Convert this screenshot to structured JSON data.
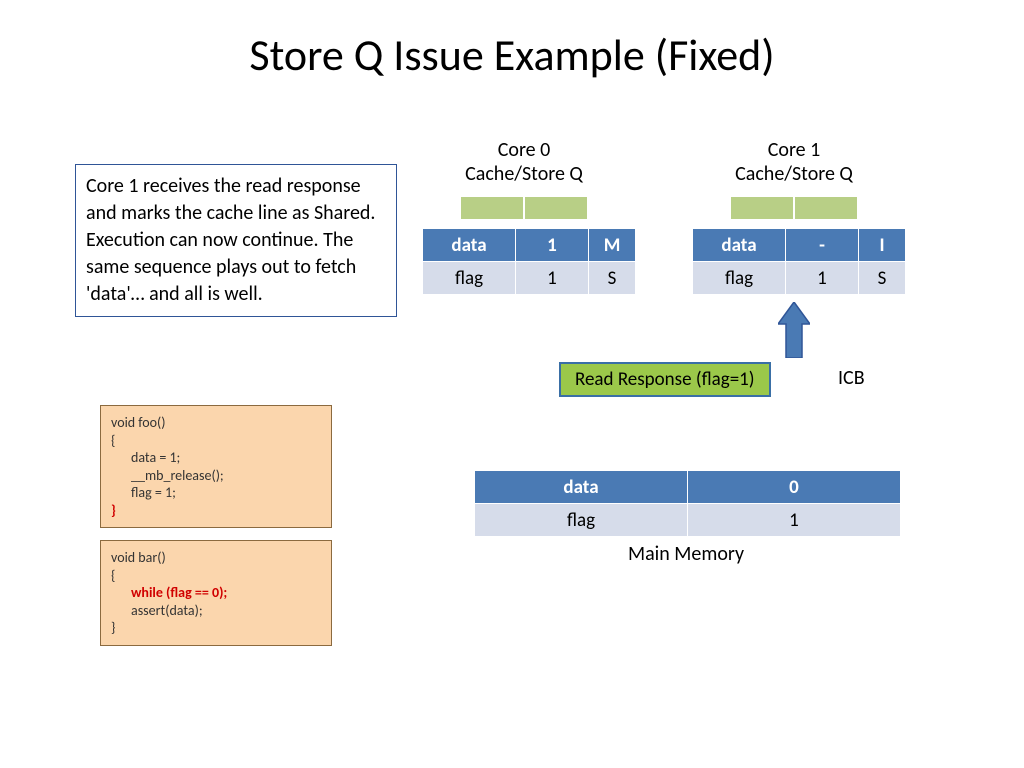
{
  "title": "Store Q Issue Example (Fixed)",
  "description": "Core 1 receives the read response and marks the cache line as Shared.\nExecution can now continue. The same sequence plays out to fetch 'data'… and all is well.",
  "core0": {
    "label": "Core 0\nCache/Store Q",
    "row1": {
      "name": "data",
      "val": "1",
      "state": "M"
    },
    "row2": {
      "name": "flag",
      "val": "1",
      "state": "S"
    }
  },
  "core1": {
    "label": "Core 1\nCache/Store Q",
    "row1": {
      "name": "data",
      "val": "-",
      "state": "I"
    },
    "row2": {
      "name": "flag",
      "val": "1",
      "state": "S"
    }
  },
  "read_response": "Read Response (flag=1)",
  "icb": "ICB",
  "main_memory": {
    "label": "Main Memory",
    "row1": {
      "name": "data",
      "val": "0"
    },
    "row2": {
      "name": "flag",
      "val": "1"
    }
  },
  "code_foo": {
    "l1": "void foo()",
    "l2": "{",
    "l3": "data = 1;",
    "l4": "__mb_release();",
    "l5": "flag = 1;",
    "l6": "}"
  },
  "code_bar": {
    "l1": "void bar()",
    "l2": "{",
    "l3": "while (flag == 0);",
    "l4": "assert(data);",
    "l5": "}"
  }
}
